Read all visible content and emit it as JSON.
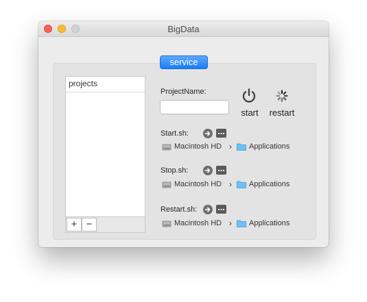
{
  "window": {
    "title": "BigData"
  },
  "tab": {
    "label": "service"
  },
  "projects": {
    "header": "projects",
    "add_label": "+",
    "remove_label": "−"
  },
  "project_name": {
    "label": "ProjectName:",
    "value": "",
    "placeholder": ""
  },
  "actions": {
    "start_label": "start",
    "restart_label": "restart"
  },
  "scripts": [
    {
      "label": "Start.sh:",
      "path": [
        "Macintosh HD",
        "Applications"
      ]
    },
    {
      "label": "Stop.sh:",
      "path": [
        "Macintosh HD",
        "Applications"
      ]
    },
    {
      "label": "Restart.sh:",
      "path": [
        "Macintosh HD",
        "Applications"
      ]
    }
  ],
  "path_separator": "›",
  "icons": {
    "power": "power-icon",
    "spinner": "spinner-icon",
    "go": "arrow-right-circle-icon",
    "browse": "ellipsis-icon",
    "disk": "hard-drive-icon",
    "folder": "folder-icon"
  },
  "colors": {
    "accent": "#1a7cf5",
    "close": "#fc5f57",
    "minimize": "#fdbc2e",
    "zoom": "#d3d3d3"
  }
}
